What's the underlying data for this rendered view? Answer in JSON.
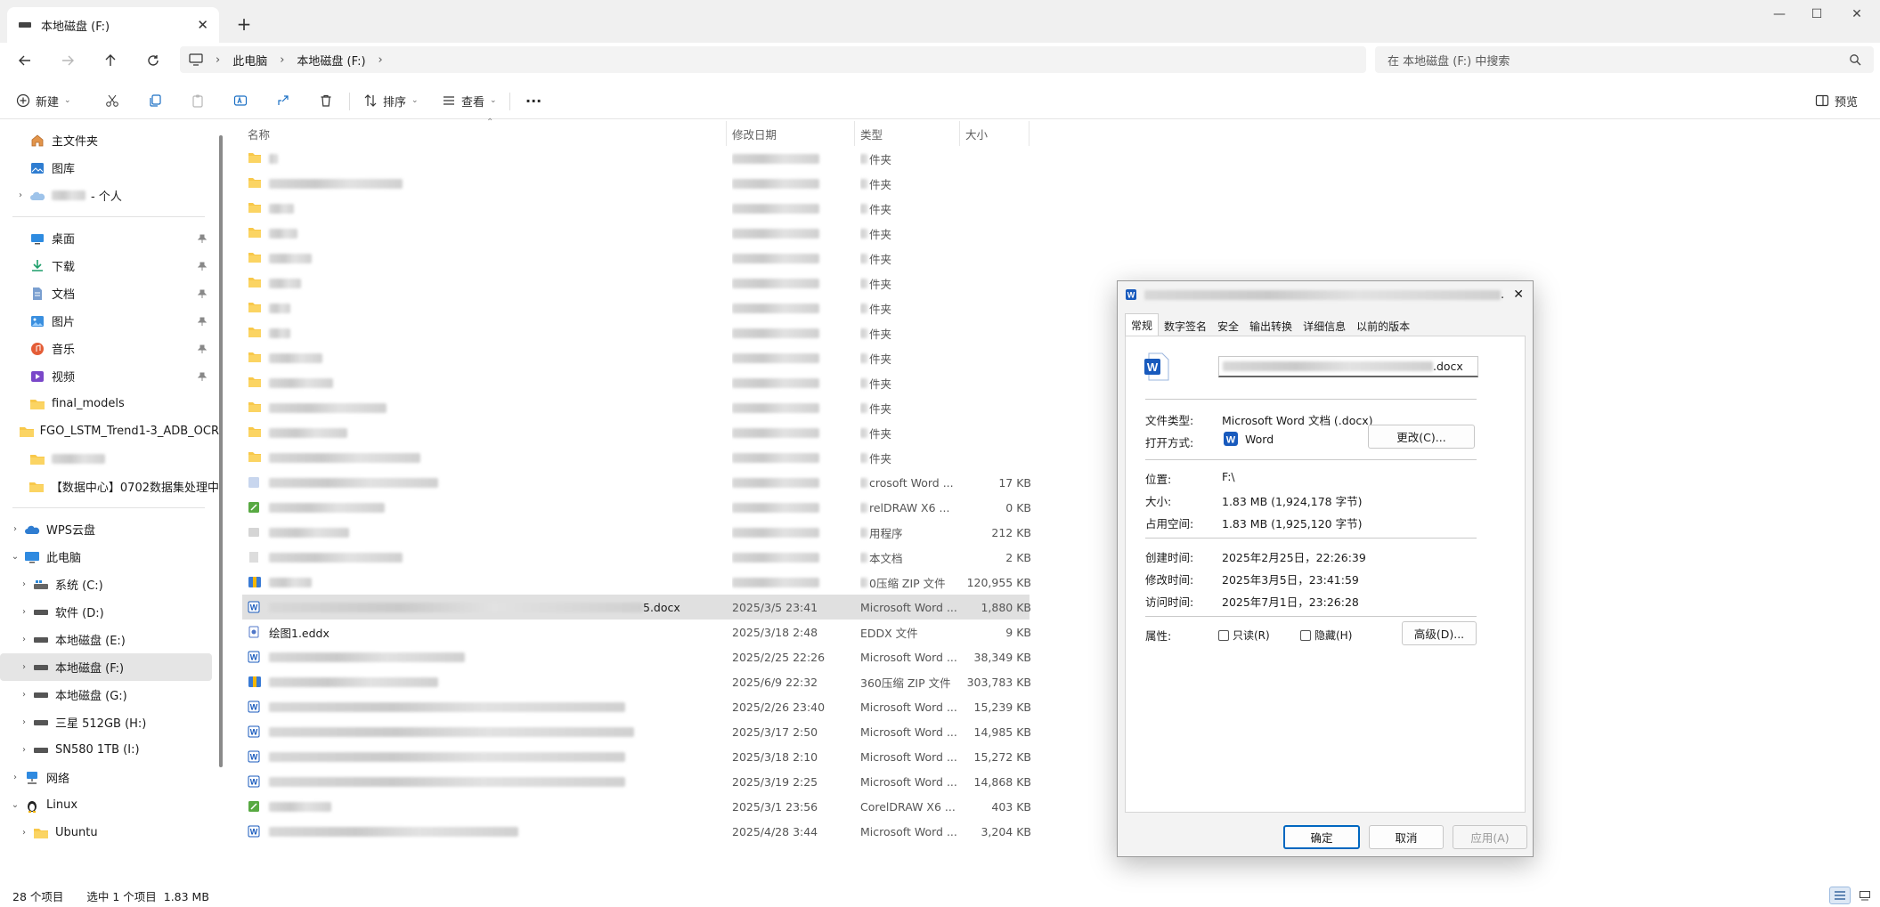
{
  "window": {
    "tab_title": "本地磁盘 (F:)",
    "close_tab": "✕",
    "new_tab": "+",
    "minimize": "—",
    "maximize": "☐",
    "close": "✕"
  },
  "address": {
    "crumbs": [
      "此电脑",
      "本地磁盘 (F:)"
    ],
    "search_placeholder": "在 本地磁盘 (F:) 中搜索"
  },
  "toolbar": {
    "new_label": "新建",
    "sort_label": "排序",
    "view_label": "查看",
    "more_label": "···",
    "preview_label": "预览"
  },
  "sidebar": {
    "top": [
      {
        "label": "主文件夹",
        "icon": "home-icon"
      },
      {
        "label": "图库",
        "icon": "gallery-icon"
      },
      {
        "label": "- 个人",
        "icon": "cloud-icon",
        "blurred_prefix": true,
        "chev": "›"
      }
    ],
    "quick": [
      {
        "label": "桌面",
        "icon": "desktop-icon",
        "pin": true
      },
      {
        "label": "下载",
        "icon": "download-icon",
        "pin": true
      },
      {
        "label": "文档",
        "icon": "document-icon",
        "pin": true
      },
      {
        "label": "图片",
        "icon": "pictures-icon",
        "pin": true
      },
      {
        "label": "音乐",
        "icon": "music-icon",
        "pin": true
      },
      {
        "label": "视频",
        "icon": "video-icon",
        "pin": true
      },
      {
        "label": "final_models",
        "icon": "folder-icon"
      },
      {
        "label": "FGO_LSTM_Trend1-3_ADB_OCR",
        "icon": "folder-icon"
      },
      {
        "label": "",
        "icon": "folder-icon",
        "blurred": true
      },
      {
        "label": "【数据中心】0702数据集处理中",
        "icon": "folder-icon"
      }
    ],
    "tree": [
      {
        "label": "WPS云盘",
        "icon": "wps-cloud-icon",
        "chev": "›",
        "indent": 0
      },
      {
        "label": "此电脑",
        "icon": "pc-icon",
        "chev": "⌄",
        "indent": 0
      },
      {
        "label": "系统 (C:)",
        "icon": "windows-drive-icon",
        "chev": "›",
        "indent": 1
      },
      {
        "label": "软件 (D:)",
        "icon": "drive-icon",
        "chev": "›",
        "indent": 1
      },
      {
        "label": "本地磁盘 (E:)",
        "icon": "drive-icon",
        "chev": "›",
        "indent": 1
      },
      {
        "label": "本地磁盘 (F:)",
        "icon": "drive-icon",
        "chev": "›",
        "indent": 1,
        "selected": true
      },
      {
        "label": "本地磁盘 (G:)",
        "icon": "drive-icon",
        "chev": "›",
        "indent": 1
      },
      {
        "label": "三星 512GB (H:)",
        "icon": "drive-icon",
        "chev": "›",
        "indent": 1
      },
      {
        "label": "SN580 1TB (I:)",
        "icon": "drive-icon",
        "chev": "›",
        "indent": 1
      },
      {
        "label": "网络",
        "icon": "network-icon",
        "chev": "›",
        "indent": 0
      },
      {
        "label": "Linux",
        "icon": "linux-icon",
        "chev": "⌄",
        "indent": 0
      },
      {
        "label": "Ubuntu",
        "icon": "folder-icon",
        "chev": "›",
        "indent": 1
      }
    ]
  },
  "columns": {
    "name": "名称",
    "date": "修改日期",
    "type": "类型",
    "size": "大小"
  },
  "files": [
    {
      "kind": "folder",
      "nw": 10,
      "type": "件夹",
      "date": "",
      "size": ""
    },
    {
      "kind": "folder",
      "nw": 150,
      "type": "件夹",
      "date": "",
      "size": ""
    },
    {
      "kind": "folder",
      "nw": 28,
      "type": "件夹",
      "date": "",
      "size": ""
    },
    {
      "kind": "folder",
      "nw": 32,
      "type": "件夹",
      "date": "",
      "size": ""
    },
    {
      "kind": "folder",
      "nw": 48,
      "type": "件夹",
      "date": "",
      "size": ""
    },
    {
      "kind": "folder",
      "nw": 36,
      "type": "件夹",
      "date": "",
      "size": ""
    },
    {
      "kind": "folder",
      "nw": 24,
      "type": "件夹",
      "date": "",
      "size": ""
    },
    {
      "kind": "folder",
      "nw": 24,
      "type": "件夹",
      "date": "",
      "size": ""
    },
    {
      "kind": "folder",
      "nw": 60,
      "type": "件夹",
      "date": "",
      "size": ""
    },
    {
      "kind": "folder",
      "nw": 72,
      "type": "件夹",
      "date": "",
      "size": ""
    },
    {
      "kind": "folder",
      "nw": 132,
      "type": "件夹",
      "date": "",
      "size": ""
    },
    {
      "kind": "folder",
      "nw": 88,
      "type": "件夹",
      "date": "",
      "size": ""
    },
    {
      "kind": "folder",
      "nw": 170,
      "type": "件夹",
      "date": "",
      "size": ""
    },
    {
      "kind": "word-blur",
      "nw": 190,
      "type": "crosoft Word ...",
      "date": "",
      "size": "17 KB"
    },
    {
      "kind": "cdr",
      "nw": 130,
      "type": "relDRAW X6 ...",
      "date": "",
      "size": "0 KB"
    },
    {
      "kind": "app",
      "nw": 90,
      "type": "用程序",
      "date": "",
      "size": "212 KB"
    },
    {
      "kind": "txt",
      "nw": 150,
      "type": "本文档",
      "date": "",
      "size": "2 KB"
    },
    {
      "kind": "zip",
      "nw": 48,
      "type": "0压缩 ZIP 文件",
      "date": "",
      "size": "120,955 KB"
    },
    {
      "kind": "word",
      "nw": 420,
      "name": "5.docx",
      "type": "Microsoft Word ...",
      "date": "2025/3/5 23:41",
      "size": "1,880 KB",
      "selected": true
    },
    {
      "kind": "eddx",
      "nw": 0,
      "name": "绘图1.eddx",
      "type": "EDDX 文件",
      "date": "2025/3/18 2:48",
      "size": "9 KB"
    },
    {
      "kind": "word",
      "nw": 220,
      "type": "Microsoft Word ...",
      "date": "2025/2/25 22:26",
      "size": "38,349 KB"
    },
    {
      "kind": "zip",
      "nw": 190,
      "type": "360压缩 ZIP 文件",
      "date": "2025/6/9 22:32",
      "size": "303,783 KB"
    },
    {
      "kind": "word",
      "nw": 400,
      "type": "Microsoft Word ...",
      "date": "2025/2/26 23:40",
      "size": "15,239 KB"
    },
    {
      "kind": "word",
      "nw": 410,
      "type": "Microsoft Word ...",
      "date": "2025/3/17 2:50",
      "size": "14,985 KB"
    },
    {
      "kind": "word",
      "nw": 400,
      "type": "Microsoft Word ...",
      "date": "2025/3/18 2:10",
      "size": "15,272 KB"
    },
    {
      "kind": "word",
      "nw": 400,
      "type": "Microsoft Word ...",
      "date": "2025/3/19 2:25",
      "size": "14,868 KB"
    },
    {
      "kind": "cdr",
      "nw": 70,
      "type": "CorelDRAW X6 ...",
      "date": "2025/3/1 23:56",
      "size": "403 KB"
    },
    {
      "kind": "word",
      "nw": 280,
      "type": "Microsoft Word ...",
      "date": "2025/4/28 3:44",
      "size": "3,204 KB"
    }
  ],
  "status": {
    "count": "28 个项目",
    "selected": "选中 1 个项目  1.83 MB"
  },
  "dialog": {
    "title_suffix": ".",
    "close": "✕",
    "tabs": [
      "常规",
      "数字签名",
      "安全",
      "输出转换",
      "详细信息",
      "以前的版本"
    ],
    "filename_suffix": ".docx",
    "rows": {
      "type_label": "文件类型:",
      "type_value": "Microsoft Word 文档 (.docx)",
      "open_label": "打开方式:",
      "open_value": "Word",
      "change_button": "更改(C)...",
      "location_label": "位置:",
      "location_value": "F:\\",
      "size_label": "大小:",
      "size_value": "1.83 MB (1,924,178 字节)",
      "disk_label": "占用空间:",
      "disk_value": "1.83 MB (1,925,120 字节)",
      "created_label": "创建时间:",
      "created_value": "2025年2月25日，22:26:39",
      "modified_label": "修改时间:",
      "modified_value": "2025年3月5日，23:41:59",
      "accessed_label": "访问时间:",
      "accessed_value": "2025年7月1日，23:26:28",
      "attr_label": "属性:",
      "readonly_label": "只读(R)",
      "hidden_label": "隐藏(H)",
      "advanced_button": "高级(D)..."
    },
    "ok": "确定",
    "cancel": "取消",
    "apply": "应用(A)"
  },
  "colors": {
    "accent": "#0067c0",
    "folder": "#f8c84a",
    "word": "#185abd",
    "selected_row": "#e0e0e0"
  }
}
